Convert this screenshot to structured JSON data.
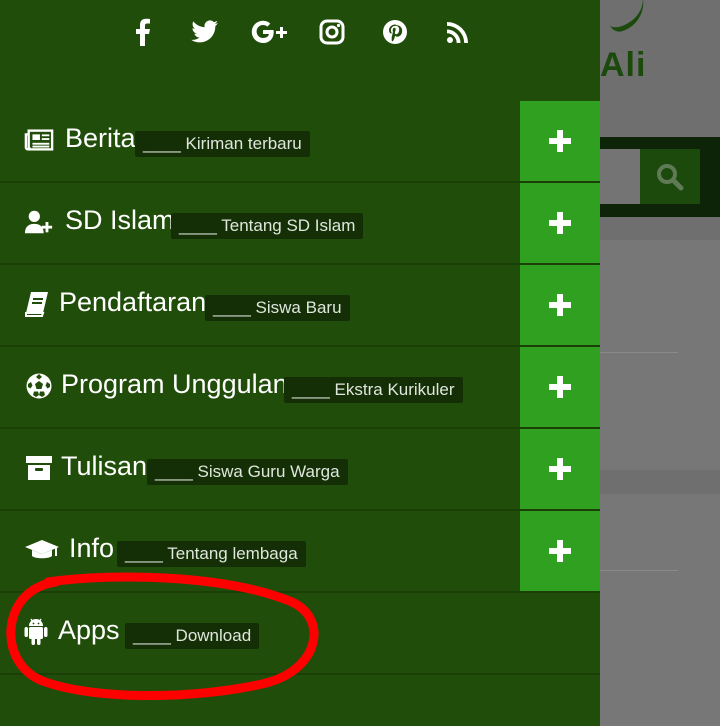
{
  "social": {
    "icons": [
      "facebook-icon",
      "twitter-icon",
      "google-plus-icon",
      "instagram-icon",
      "pinterest-icon",
      "rss-icon"
    ]
  },
  "menu": {
    "items": [
      {
        "title": "Berita",
        "tag": "____ Kiriman terbaru",
        "icon": "newspaper-icon",
        "expandable": true
      },
      {
        "title": "SD Islam",
        "tag": "____ Tentang SD Islam",
        "icon": "user-plus-icon",
        "expandable": true
      },
      {
        "title": "Pendaftaran",
        "tag": "____ Siswa Baru",
        "icon": "book-icon",
        "expandable": true
      },
      {
        "title": "Program Unggulan",
        "tag": "____ Ekstra Kurikuler",
        "icon": "soccer-ball-icon",
        "expandable": true
      },
      {
        "title": "Tulisan",
        "tag": "____ Siswa Guru Warga",
        "icon": "archive-icon",
        "expandable": true
      },
      {
        "title": "Info",
        "tag": "____ Tentang lembaga",
        "icon": "graduation-cap-icon",
        "expandable": true
      },
      {
        "title": "Apps",
        "tag": "____ Download",
        "icon": "android-icon",
        "expandable": false
      }
    ]
  },
  "background": {
    "logo_text": "Ali"
  },
  "colors": {
    "drawer": "#214d0a",
    "plus_button": "#2fa020",
    "tag_bg": "#142e06",
    "annotation": "#ff0000"
  }
}
